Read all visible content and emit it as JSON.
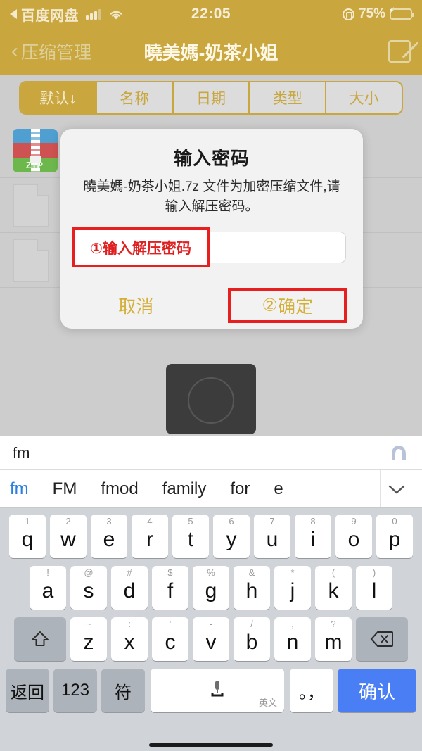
{
  "status_bar": {
    "back_app": "百度网盘",
    "back_icon": "back-triangle-icon",
    "signal_icon": "cellular-signal-icon",
    "wifi_icon": "wifi-icon",
    "time": "22:05",
    "rotation_lock_icon": "rotation-lock-icon",
    "battery_percent": "75%",
    "battery_icon": "battery-charging-icon",
    "charging_bolt": "⚡"
  },
  "nav_bar": {
    "back_icon": "chevron-left-icon",
    "back_label": "压缩管理",
    "title": "曉美媽-奶茶小姐",
    "edit_icon": "compose-edit-icon"
  },
  "sort_tabs": {
    "items": [
      {
        "label": "默认↓",
        "active": true
      },
      {
        "label": "名称",
        "active": false
      },
      {
        "label": "日期",
        "active": false
      },
      {
        "label": "类型",
        "active": false
      },
      {
        "label": "大小",
        "active": false
      }
    ]
  },
  "file_list": {
    "rows": [
      {
        "icon": "zip-file-icon",
        "icon_label": "ZIP"
      },
      {
        "icon": "document-file-icon",
        "icon_label": ""
      },
      {
        "icon": "document-file-icon",
        "icon_label": ""
      }
    ]
  },
  "dialog": {
    "title": "输入密码",
    "message": "曉美媽-奶茶小姐.7z 文件为加密压缩文件,请输入解压密码。",
    "input_value": "",
    "input_placeholder": "",
    "annotation_input": "①输入解压密码",
    "cancel_label": "取消",
    "confirm_number": "②",
    "confirm_label": "确定"
  },
  "thumbnail": {
    "shape_icon": "circle-outline-icon"
  },
  "keyboard": {
    "compose_text": "fm",
    "ime_logo_icon": "ime-logo-icon",
    "candidates": [
      "fm",
      "FM",
      "fmod",
      "family",
      "for",
      "e"
    ],
    "candidate_selected_index": 0,
    "expand_icon": "chevron-down-icon",
    "row1": [
      {
        "hint": "1",
        "key": "q"
      },
      {
        "hint": "2",
        "key": "w"
      },
      {
        "hint": "3",
        "key": "e"
      },
      {
        "hint": "4",
        "key": "r"
      },
      {
        "hint": "5",
        "key": "t"
      },
      {
        "hint": "6",
        "key": "y"
      },
      {
        "hint": "7",
        "key": "u"
      },
      {
        "hint": "8",
        "key": "i"
      },
      {
        "hint": "9",
        "key": "o"
      },
      {
        "hint": "0",
        "key": "p"
      }
    ],
    "row2": [
      {
        "hint": "!",
        "key": "a"
      },
      {
        "hint": "@",
        "key": "s"
      },
      {
        "hint": "#",
        "key": "d"
      },
      {
        "hint": "$",
        "key": "f"
      },
      {
        "hint": "%",
        "key": "g"
      },
      {
        "hint": "&",
        "key": "h"
      },
      {
        "hint": "*",
        "key": "j"
      },
      {
        "hint": "(",
        "key": "k"
      },
      {
        "hint": ")",
        "key": "l"
      }
    ],
    "row3": [
      {
        "hint": "~",
        "key": "z"
      },
      {
        "hint": ":",
        "key": "x"
      },
      {
        "hint": "'",
        "key": "c"
      },
      {
        "hint": "-",
        "key": "v"
      },
      {
        "hint": "/",
        "key": "b"
      },
      {
        "hint": ",",
        "key": "n"
      },
      {
        "hint": "?",
        "key": "m"
      }
    ],
    "shift_icon": "shift-arrow-icon",
    "backspace_icon": "backspace-delete-icon",
    "return_label": "返回",
    "numbers_label": "123",
    "symbols_label": "符",
    "space_mic_icon": "microphone-icon",
    "space_lang_label": "英文",
    "punctuation_label": "。，",
    "enter_label": "确认"
  },
  "colors": {
    "brand_gold": "#c9a63e",
    "annotation_red": "#e81f1f",
    "enter_blue": "#4a7ef5",
    "battery_green": "#4cd24c"
  }
}
